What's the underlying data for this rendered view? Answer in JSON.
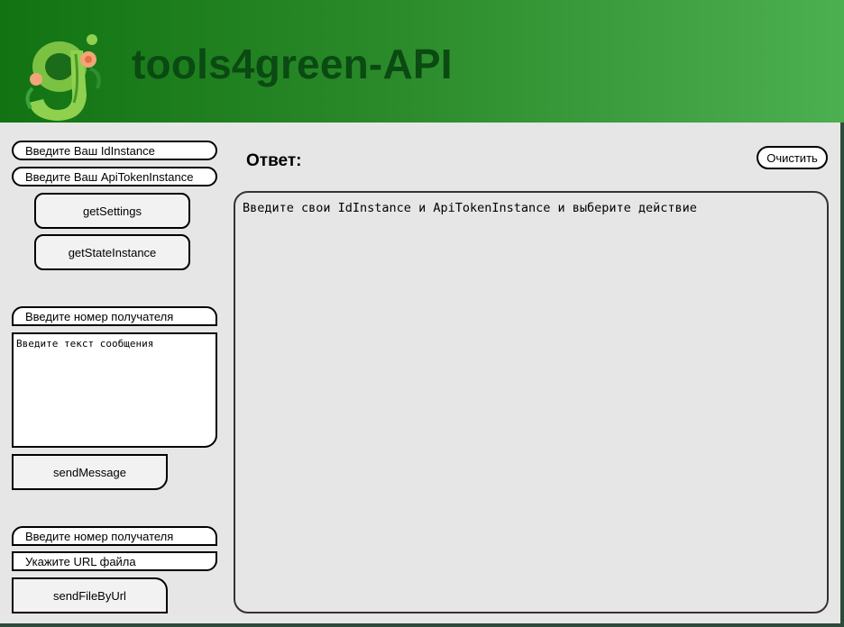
{
  "header": {
    "title": "tools4green-API",
    "logo_icon": "green-g-floral-logo",
    "gradient": [
      "#127312",
      "#4caf50"
    ]
  },
  "credentials": {
    "id_placeholder": "Введите Ваш IdInstance",
    "token_placeholder": "Введите Ваш ApiTokenInstance"
  },
  "actions": {
    "get_settings": "getSettings",
    "get_state": "getStateInstance"
  },
  "send_message": {
    "recipient_placeholder": "Введите номер получателя",
    "text_placeholder": "Введите текст сообщения",
    "button": "sendMessage"
  },
  "send_file": {
    "recipient_placeholder": "Введите номер получателя",
    "url_placeholder": "Укажите URL файла",
    "button": "sendFileByUrl"
  },
  "response": {
    "label": "Ответ:",
    "clear_button": "Очистить",
    "text": "Введите свои IdInstance и ApiTokenInstance и выберите действие"
  }
}
